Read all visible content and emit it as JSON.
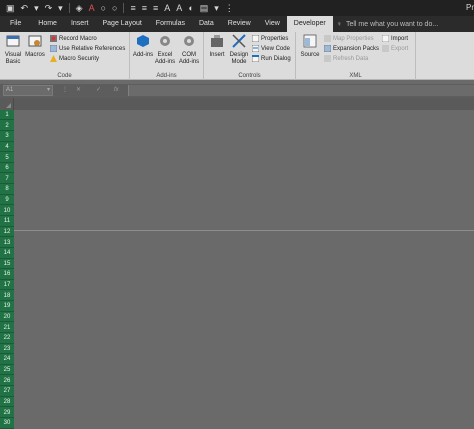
{
  "window": {
    "title_fragment": "Pr"
  },
  "colors": {
    "accent": "#217346",
    "ribbon": "#dcdcdc",
    "titlebar": "#212121"
  },
  "tabs": [
    "File",
    "Home",
    "Insert",
    "Page Layout",
    "Formulas",
    "Data",
    "Review",
    "View",
    "Developer"
  ],
  "active_tab": "Developer",
  "tell_me": "Tell me what you want to do...",
  "ribbon": {
    "code": {
      "label": "Code",
      "visual_basic": "Visual Basic",
      "macros": "Macros",
      "record_macro": "Record Macro",
      "use_relative": "Use Relative References",
      "macro_security": "Macro Security"
    },
    "addins": {
      "label": "Add-ins",
      "addins": "Add-ins",
      "excel_addins": "Excel Add-ins",
      "com_addins": "COM Add-ins"
    },
    "controls": {
      "label": "Controls",
      "insert": "Insert",
      "design_mode": "Design Mode",
      "properties": "Properties",
      "view_code": "View Code",
      "run_dialog": "Run Dialog"
    },
    "xml": {
      "label": "XML",
      "source": "Source",
      "map_properties": "Map Properties",
      "expansion_packs": "Expansion Packs",
      "refresh_data": "Refresh Data",
      "import": "Import",
      "export": "Export"
    }
  },
  "formula_bar": {
    "name_box": "A1",
    "fx": "fx",
    "formula": ""
  },
  "rows": [
    "1",
    "2",
    "3",
    "4",
    "5",
    "6",
    "7",
    "8",
    "9",
    "10",
    "11",
    "12",
    "13",
    "14",
    "15",
    "16",
    "17",
    "18",
    "19",
    "20",
    "21",
    "22",
    "23",
    "24",
    "25",
    "26",
    "27",
    "28",
    "29",
    "30"
  ]
}
